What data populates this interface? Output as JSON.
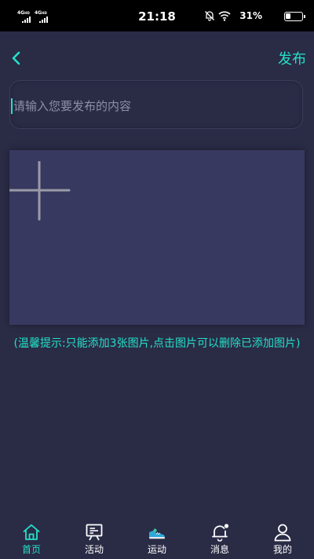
{
  "status_bar": {
    "net1": "4G",
    "net1_hd": "HD",
    "net2": "4G",
    "net2_hd": "HD",
    "time": "21:18",
    "battery_text": "31%",
    "battery_level": 0.31
  },
  "header": {
    "back_icon": "chevron-left-icon",
    "publish_label": "发布"
  },
  "editor": {
    "placeholder": "请输入您要发布的内容",
    "value": ""
  },
  "images": {
    "add_icon": "plus-icon",
    "hint": "(温馨提示:只能添加3张图片,点击图片可以删除已添加图片)"
  },
  "tabs": [
    {
      "label": "首页",
      "icon": "home-icon",
      "active": true
    },
    {
      "label": "活动",
      "icon": "presentation-board-icon",
      "active": false
    },
    {
      "label": "运动",
      "icon": "sneaker-icon",
      "active": false
    },
    {
      "label": "消息",
      "icon": "bell-icon",
      "active": false,
      "badge": true
    },
    {
      "label": "我的",
      "icon": "user-icon",
      "active": false
    }
  ],
  "colors": {
    "accent": "#23e0c9",
    "background": "#2a2b45",
    "image_area": "#383960"
  }
}
